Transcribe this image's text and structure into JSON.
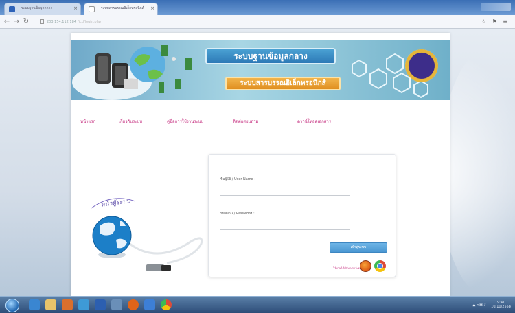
{
  "browser": {
    "tabs": [
      {
        "label": "ระบบฐานข้อมูลกลาง"
      },
      {
        "label": "ระบบสารบรรณอิเล็กทรอนิกส์"
      }
    ],
    "url_host": "203.154.112.184",
    "url_path": "/icd/login.php"
  },
  "banner": {
    "title": "ระบบฐานข้อมูลกลาง",
    "subtitle": "ระบบสารบรรณอิเล็กทรอนิกส์"
  },
  "menu": {
    "items": [
      {
        "label": "หน้าแรก"
      },
      {
        "label": "เกี่ยวกับระบบ"
      },
      {
        "label": "คู่มือการใช้งานระบบ"
      },
      {
        "label": "ติดต่อสอบถาม"
      },
      {
        "label": "ดาวน์โหลดเอกสาร"
      }
    ]
  },
  "login": {
    "username_label": "ชื่อผู้ใช้ / User Name :",
    "username_value": "",
    "password_label": "รหัสผ่าน / Password :",
    "password_value": "",
    "button_label": "เข้าสู่ระบบ",
    "browser_note": "ใช้งานได้ดีกับเบราว์เซอร์"
  },
  "illustration": {
    "text": "หน้าผู้ระบบ"
  },
  "taskbar": {
    "time": "9:41",
    "date": "10/10/2558"
  },
  "colors": {
    "menu_text": "#c4297c",
    "button": "#4a97d2",
    "banner": "#6fa9c9"
  }
}
